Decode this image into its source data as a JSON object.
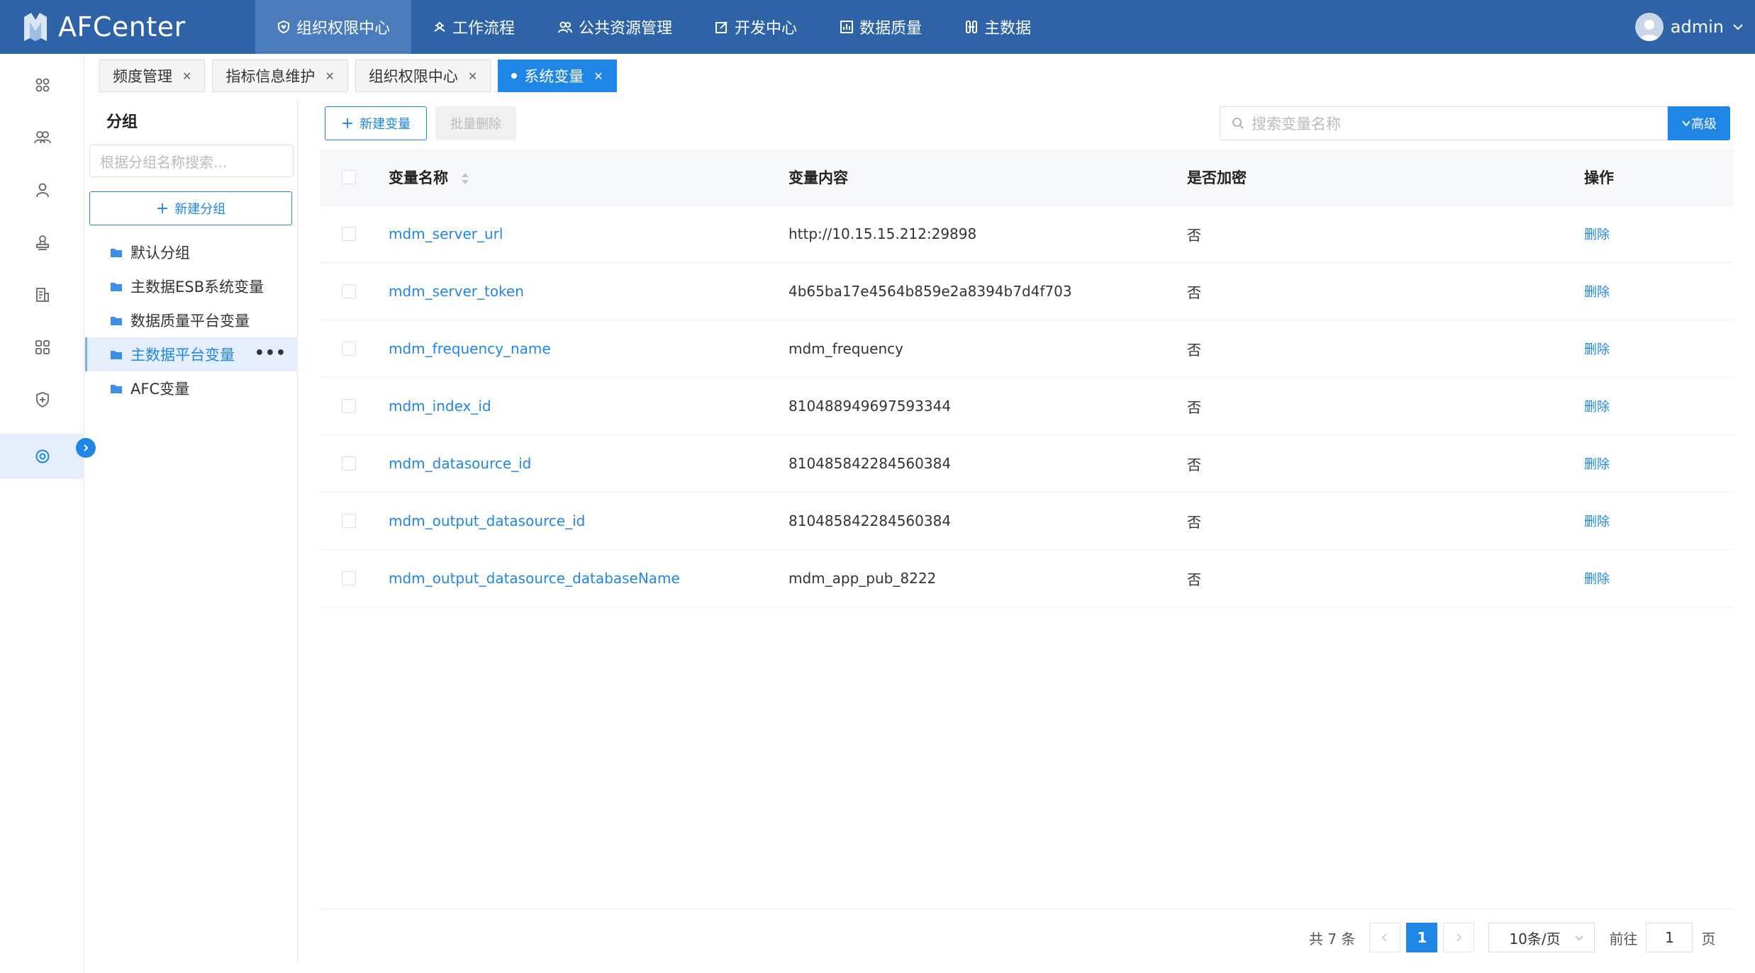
{
  "app": {
    "title": "AFCenter"
  },
  "nav": {
    "items": [
      {
        "label": "组织权限中心",
        "icon": "shield-heart-icon",
        "active": true
      },
      {
        "label": "工作流程",
        "icon": "workflow-icon",
        "active": false
      },
      {
        "label": "公共资源管理",
        "icon": "people-icon",
        "active": false
      },
      {
        "label": "开发中心",
        "icon": "edit-icon",
        "active": false
      },
      {
        "label": "数据质量",
        "icon": "chart-icon",
        "active": false
      },
      {
        "label": "主数据",
        "icon": "data-icon",
        "active": false
      }
    ]
  },
  "user": {
    "name": "admin"
  },
  "sidebar": {
    "icons": [
      "apps-icon",
      "users-group-icon",
      "user-icon",
      "user-stamp-icon",
      "document-list-icon",
      "grid-icon",
      "security-icon",
      "settings-icon"
    ],
    "active_index": 7
  },
  "tabs": [
    {
      "label": "频度管理",
      "active": false
    },
    {
      "label": "指标信息维护",
      "active": false
    },
    {
      "label": "组织权限中心",
      "active": false
    },
    {
      "label": "系统变量",
      "active": true
    }
  ],
  "groups": {
    "title": "分组",
    "search_placeholder": "根据分组名称搜索...",
    "new_button": "新建分组",
    "items": [
      {
        "label": "默认分组",
        "active": false
      },
      {
        "label": "主数据ESB系统变量",
        "active": false
      },
      {
        "label": "数据质量平台变量",
        "active": false
      },
      {
        "label": "主数据平台变量",
        "active": true
      },
      {
        "label": "AFC变量",
        "active": false
      }
    ],
    "more_label": "•••"
  },
  "toolbar": {
    "new_label": "新建变量",
    "batch_delete_label": "批量删除",
    "search_placeholder": "搜索变量名称",
    "advanced_label": "高级"
  },
  "table": {
    "headers": {
      "name": "变量名称",
      "content": "变量内容",
      "encrypted": "是否加密",
      "ops": "操作"
    },
    "rows": [
      {
        "name": "mdm_server_url",
        "content": "http://10.15.15.212:29898",
        "encrypted": "否",
        "op": "删除"
      },
      {
        "name": "mdm_server_token",
        "content": "4b65ba17e4564b859e2a8394b7d4f703",
        "encrypted": "否",
        "op": "删除"
      },
      {
        "name": "mdm_frequency_name",
        "content": "mdm_frequency",
        "encrypted": "否",
        "op": "删除"
      },
      {
        "name": "mdm_index_id",
        "content": "810488949697593344",
        "encrypted": "否",
        "op": "删除"
      },
      {
        "name": "mdm_datasource_id",
        "content": "810485842284560384",
        "encrypted": "否",
        "op": "删除"
      },
      {
        "name": "mdm_output_datasource_id",
        "content": "810485842284560384",
        "encrypted": "否",
        "op": "删除"
      },
      {
        "name": "mdm_output_datasource_databaseName",
        "content": "mdm_app_pub_8222",
        "encrypted": "否",
        "op": "删除"
      }
    ]
  },
  "pagination": {
    "total_text": "共 7 条",
    "current_page": "1",
    "page_size": "10条/页",
    "goto_label": "前往",
    "goto_value": "1",
    "page_suffix": "页"
  },
  "colors": {
    "primary": "#1f86e6",
    "topbar": "#2e63a8",
    "nav_active": "#4a7bbb"
  }
}
